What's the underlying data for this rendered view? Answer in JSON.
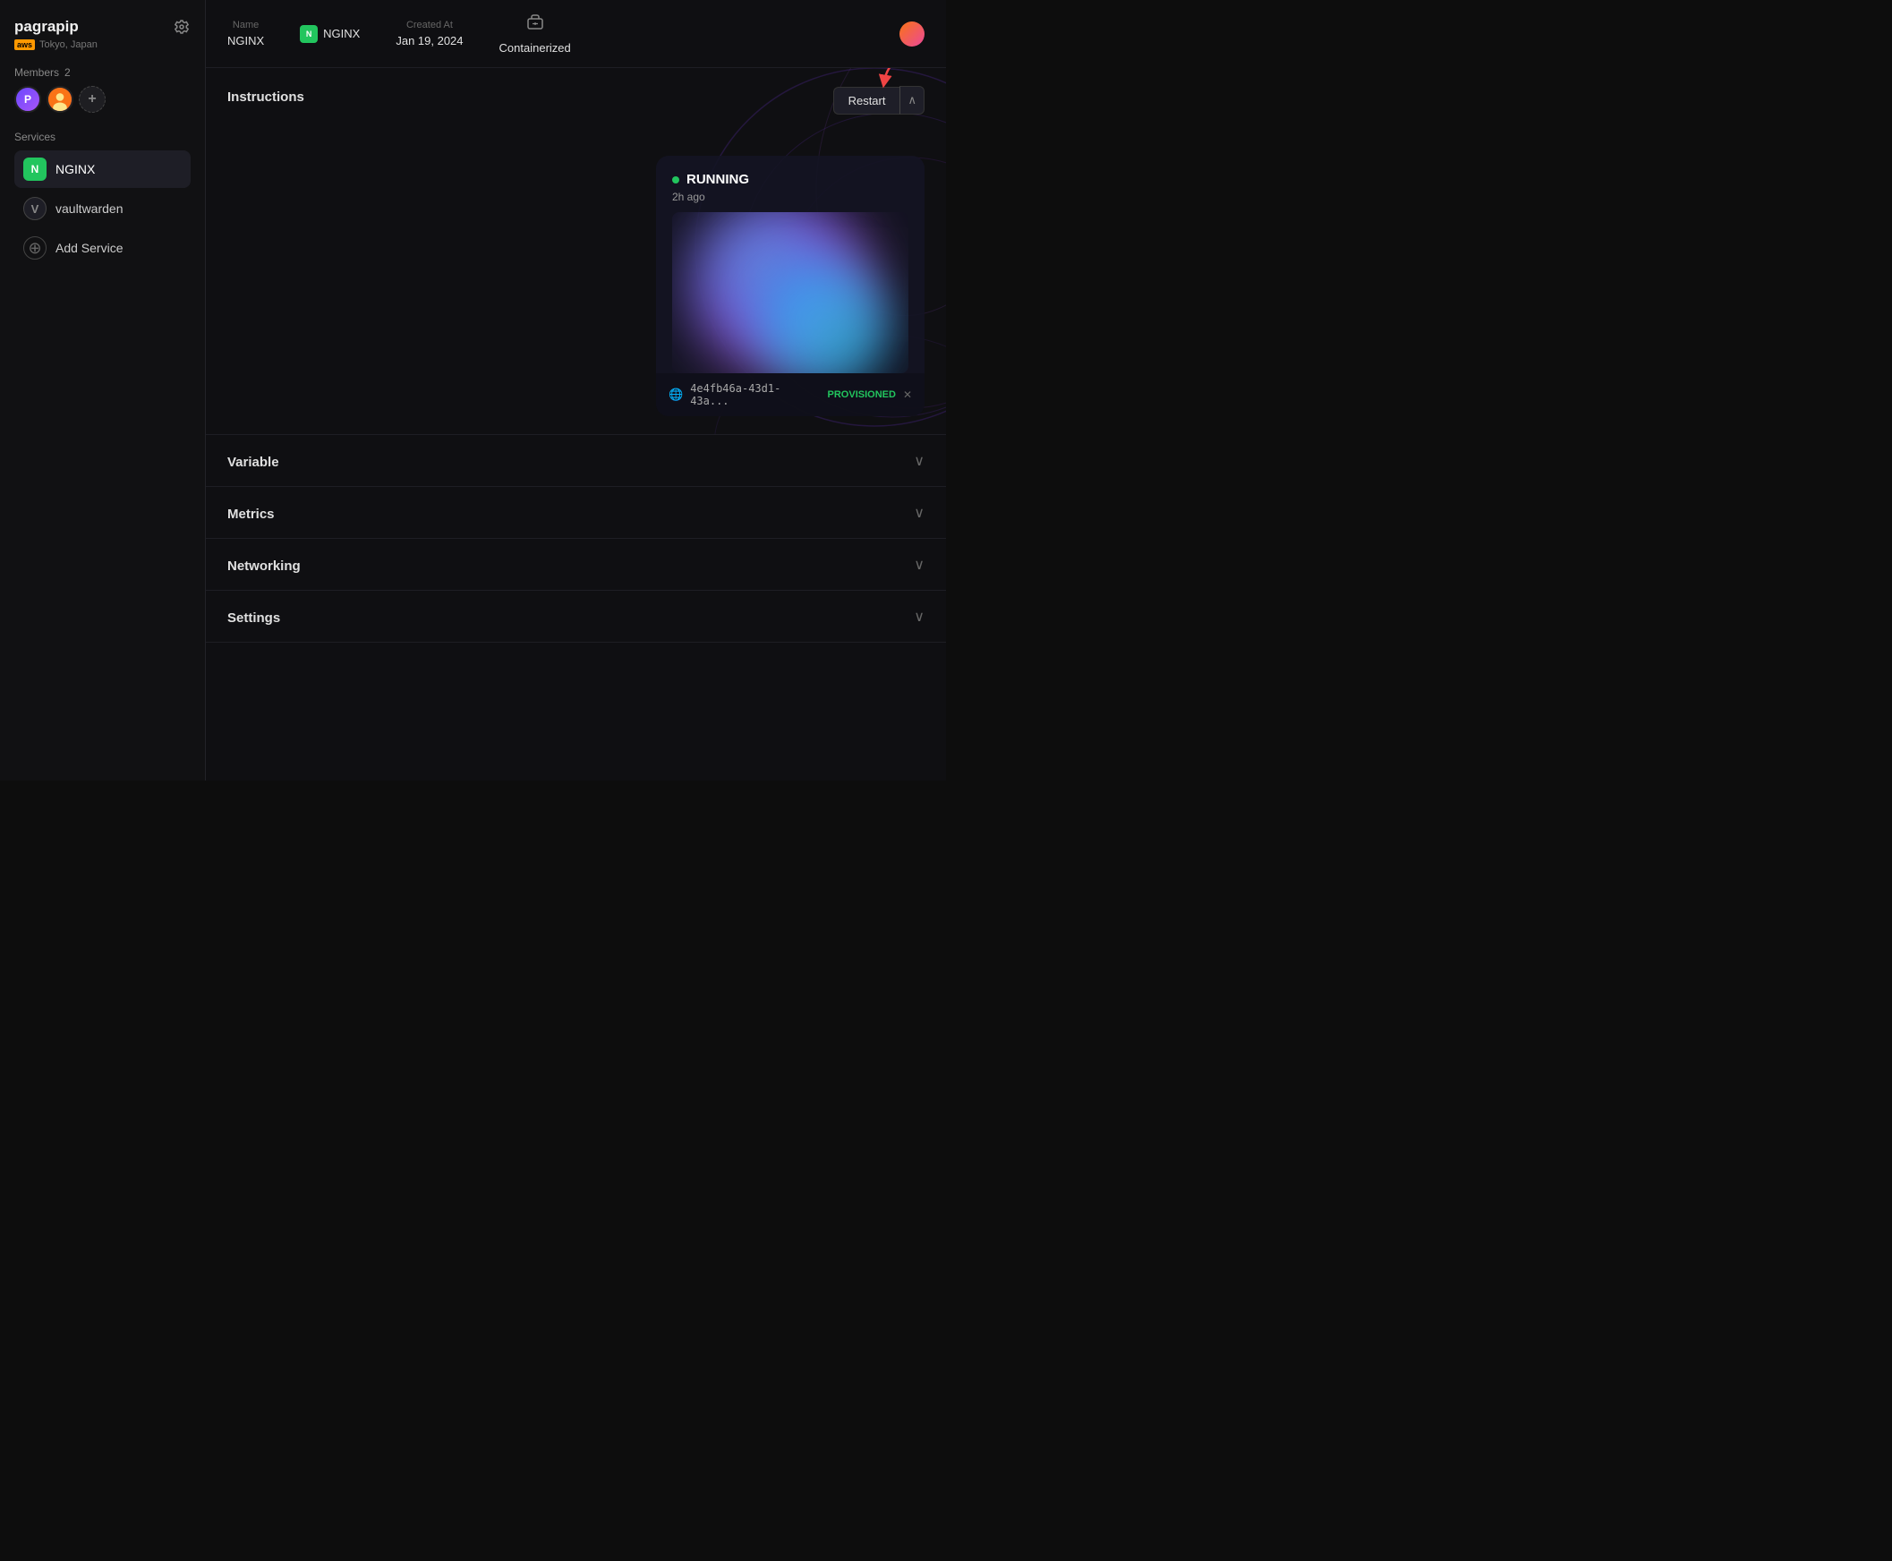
{
  "sidebar": {
    "project": {
      "name": "pagrapip",
      "region": "Tokyo, Japan",
      "aws_label": "aws"
    },
    "members": {
      "label": "Members",
      "count": "2"
    },
    "services": {
      "label": "Services",
      "items": [
        {
          "id": "nginx",
          "name": "NGINX",
          "active": true
        },
        {
          "id": "vaultwarden",
          "name": "vaultwarden",
          "active": false
        },
        {
          "id": "add",
          "name": "Add Service",
          "active": false
        }
      ]
    }
  },
  "header": {
    "name_label": "Name",
    "name_value": "NGINX",
    "service_label": "NGINX",
    "created_label": "Created At",
    "created_value": "Jan 19, 2024",
    "type_label": "Containerized"
  },
  "instructions": {
    "title": "Instructions",
    "restart_label": "Restart"
  },
  "running_card": {
    "status": "RUNNING",
    "time_ago": "2h ago",
    "provision_id": "4e4fb46a-43d1-43a...",
    "provisioned_label": "PROVISIONED"
  },
  "sections": [
    {
      "id": "variable",
      "label": "Variable"
    },
    {
      "id": "metrics",
      "label": "Metrics"
    },
    {
      "id": "networking",
      "label": "Networking"
    },
    {
      "id": "settings",
      "label": "Settings"
    }
  ]
}
